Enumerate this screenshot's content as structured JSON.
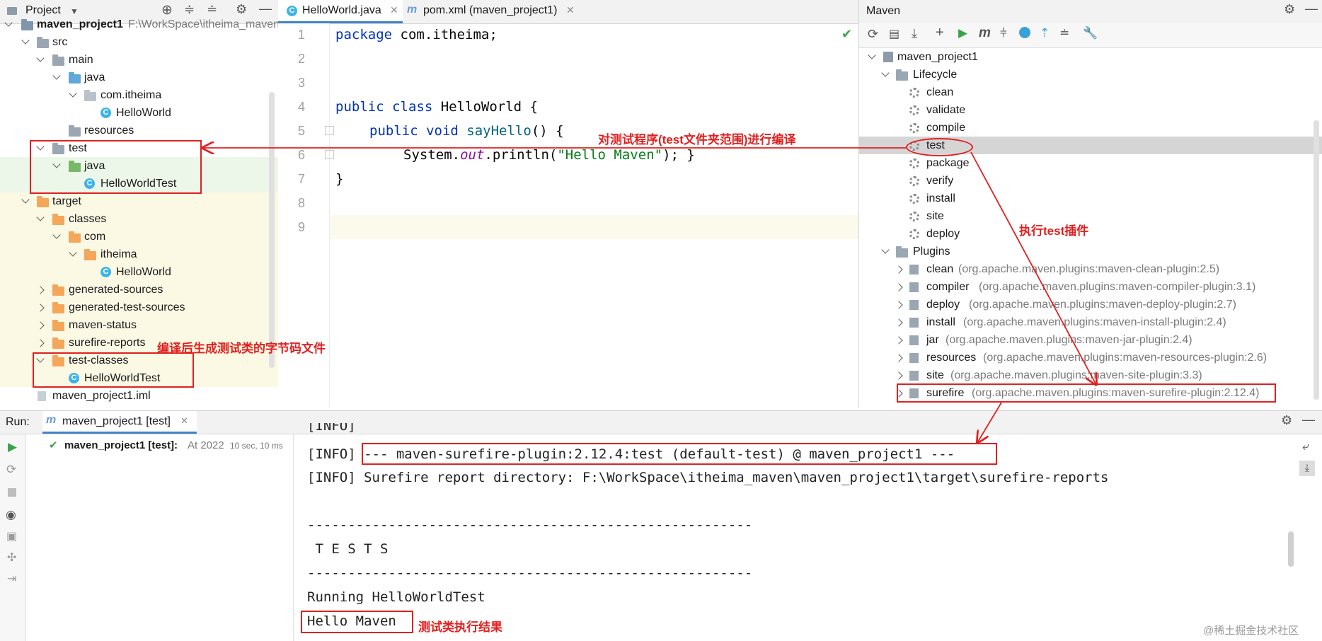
{
  "project": {
    "title": "Project",
    "root_name": "maven_project1",
    "root_path": "F:\\WorkSpace\\itheima_maven",
    "tree": {
      "src": "src",
      "main": "main",
      "java_main": "java",
      "package": "com.itheima",
      "helloworld": "HelloWorld",
      "resources": "resources",
      "test": "test",
      "java_test": "java",
      "helloworldtest": "HelloWorldTest",
      "target": "target",
      "classes": "classes",
      "com": "com",
      "itheima": "itheima",
      "helloworld_class": "HelloWorld",
      "generated_sources": "generated-sources",
      "generated_test_sources": "generated-test-sources",
      "maven_status": "maven-status",
      "surefire_reports": "surefire-reports",
      "test_classes": "test-classes",
      "helloworldtest_class": "HelloWorldTest",
      "iml": "maven_project1.iml"
    }
  },
  "editor": {
    "tabs": [
      {
        "label": "HelloWorld.java",
        "active": true
      },
      {
        "label": "pom.xml (maven_project1)",
        "active": false
      }
    ],
    "line_numbers": [
      "1",
      "2",
      "3",
      "4",
      "5",
      "6",
      "7",
      "8",
      "9"
    ],
    "code": {
      "l1_kw": "package",
      "l1_rest": " com.itheima;",
      "l4_kw": "public class",
      "l4_rest": " HelloWorld {",
      "l5_kw": "public void",
      "l5_fn": "sayHello",
      "l5_rest": "() {",
      "l6_a": "System.",
      "l6_b": "out",
      "l6_c": ".println(",
      "l6_str": "\"Hello Maven\"",
      "l6_d": "); }",
      "l8": "}"
    }
  },
  "maven": {
    "title": "Maven",
    "project": "maven_project1",
    "lifecycle_label": "Lifecycle",
    "lifecycle": [
      "clean",
      "validate",
      "compile",
      "test",
      "package",
      "verify",
      "install",
      "site",
      "deploy"
    ],
    "plugins_label": "Plugins",
    "plugins": [
      {
        "name": "clean",
        "coord": "(org.apache.maven.plugins:maven-clean-plugin:2.5)"
      },
      {
        "name": "compiler",
        "coord": "(org.apache.maven.plugins:maven-compiler-plugin:3.1)"
      },
      {
        "name": "deploy",
        "coord": "(org.apache.maven.plugins:maven-deploy-plugin:2.7)"
      },
      {
        "name": "install",
        "coord": "(org.apache.maven.plugins:maven-install-plugin:2.4)"
      },
      {
        "name": "jar",
        "coord": "(org.apache.maven.plugins:maven-jar-plugin:2.4)"
      },
      {
        "name": "resources",
        "coord": "(org.apache.maven.plugins:maven-resources-plugin:2.6)"
      },
      {
        "name": "site",
        "coord": "(org.apache.maven.plugins:maven-site-plugin:3.3)"
      },
      {
        "name": "surefire",
        "coord": "(org.apache.maven.plugins:maven-surefire-plugin:2.12.4)"
      }
    ]
  },
  "run": {
    "label": "Run:",
    "tab": "maven_project1 [test]",
    "tree_item": "maven_project1 [test]:",
    "tree_time": "At 2022",
    "tree_duration": "10 sec, 10 ms",
    "console": {
      "partial": "[INFO]",
      "l1_prefix": "[INFO]",
      "l1_boxed": "--- maven-surefire-plugin:2.12.4:test (default-test) @ maven_project1 ---",
      "l2": "[INFO] Surefire report directory: F:\\WorkSpace\\itheima_maven\\maven_project1\\target\\surefire-reports",
      "sep1": "-------------------------------------------------------",
      "tests": " T E S T S",
      "sep2": "-------------------------------------------------------",
      "running": "Running HelloWorldTest",
      "result": "Hello Maven"
    }
  },
  "annotations": {
    "compile_test": "对测试程序(test文件夹范围)进行编译",
    "run_plugin": "执行test插件",
    "bytecode": "编译后生成测试类的字节码文件",
    "result": "测试类执行结果"
  },
  "watermark": "@稀土掘金技术社区"
}
